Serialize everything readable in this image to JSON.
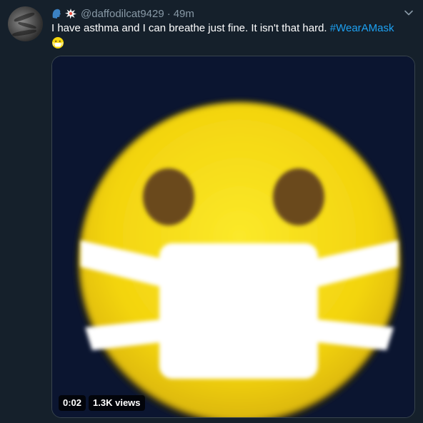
{
  "tweet": {
    "handle": "@daffodilcat9429",
    "separator": "·",
    "time": "49m",
    "name_icons": [
      "speaking-head-icon",
      "collision-icon"
    ],
    "text": "I have asthma and I can breathe just fine. It isn't that hard.",
    "hashtag": "#WearAMask",
    "trailing_emoji": "face-with-medical-mask-icon"
  },
  "media": {
    "type": "video",
    "duration": "0:02",
    "views": "1.3K views",
    "content_icon": "face-with-medical-mask-icon"
  },
  "colors": {
    "background": "#15202b",
    "secondary_text": "#8899a6",
    "hashtag": "#1da1f2",
    "media_bg": "#0b1530",
    "emoji_yellow": "#f5d60c"
  }
}
